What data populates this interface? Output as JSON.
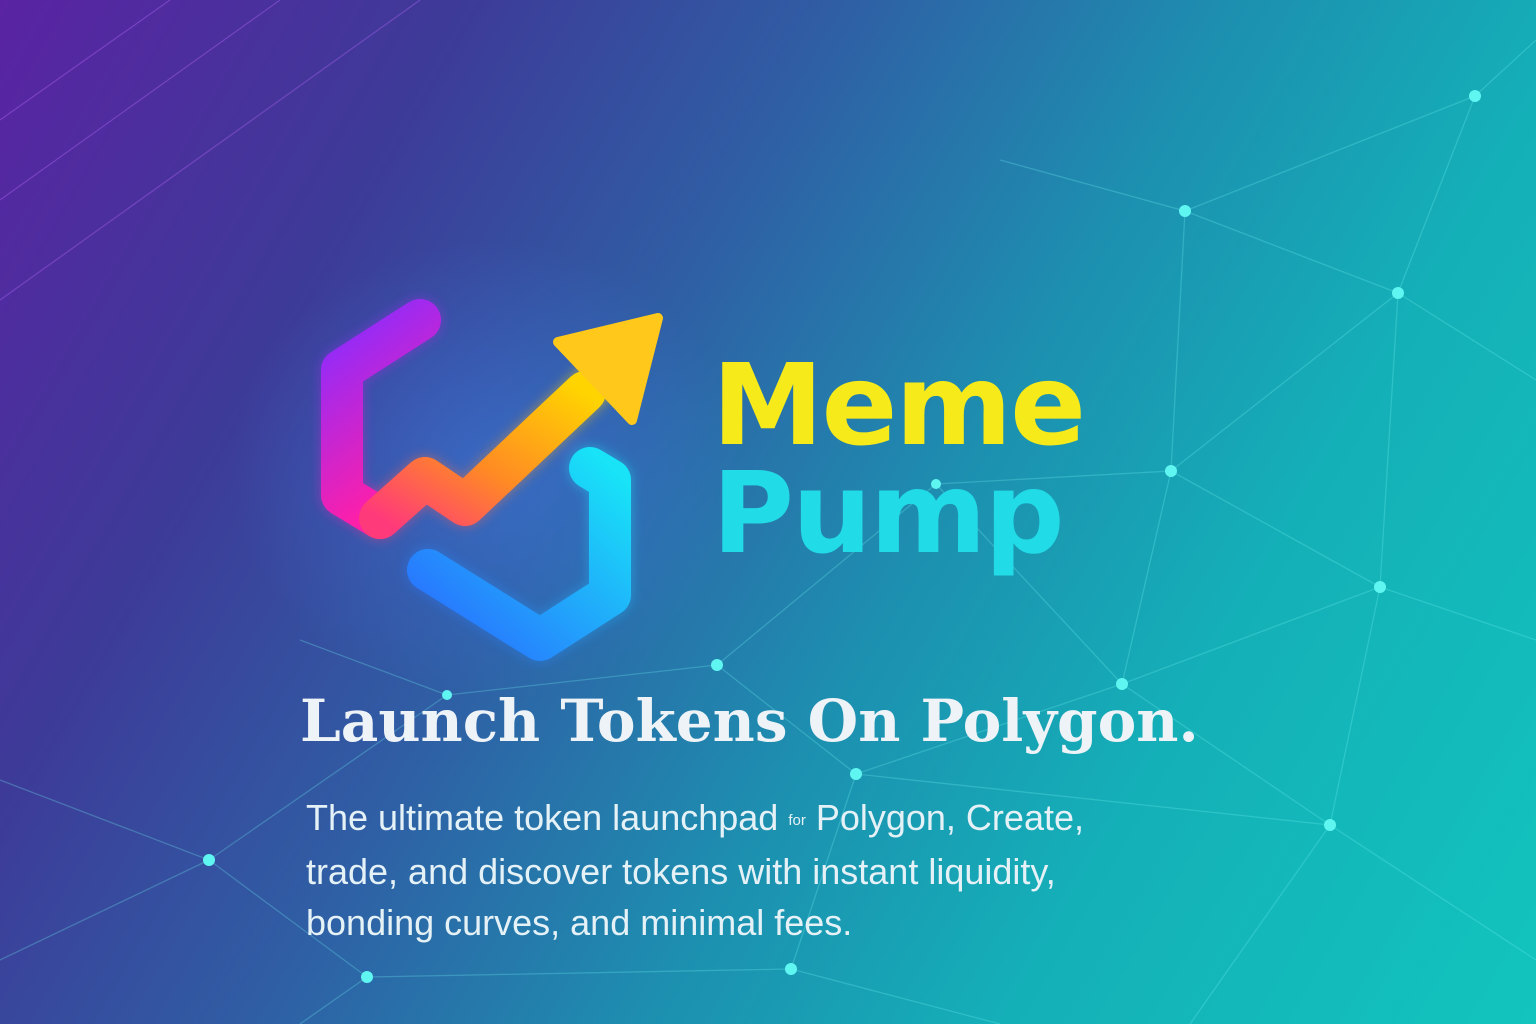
{
  "brand": {
    "line1": "Meme",
    "line2": "Pump",
    "logo_icon": "hexagon-chain-rising-arrow-icon"
  },
  "hero": {
    "headline": "Launch Tokens On Polygon.",
    "description_lines": [
      {
        "before": "The ultimate  token launchpad ",
        "small": "for",
        "after": " Polygon, Create,"
      },
      {
        "text": "trade, and discover tokens with instant liquidity,"
      },
      {
        "text": "bonding curves, and minimal fees."
      }
    ]
  },
  "colors": {
    "meme_yellow": "#f6ea1a",
    "pump_cyan": "#21dbe6",
    "bg_purple": "#5a23a3",
    "bg_teal": "#12c4bd"
  }
}
